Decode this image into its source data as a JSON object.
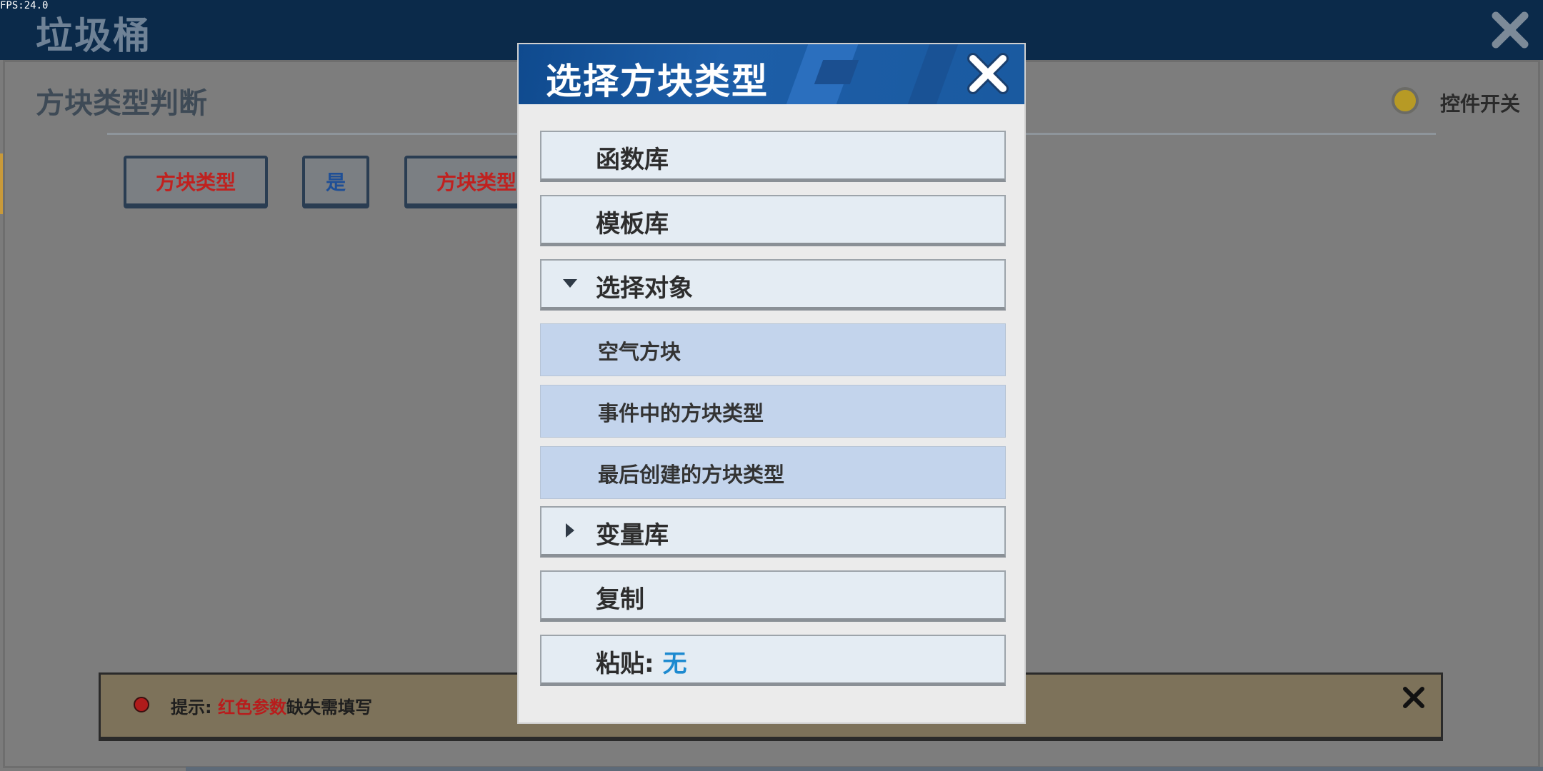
{
  "fps": "FPS:24.0",
  "app": {
    "title": "垃圾桶"
  },
  "section": {
    "title": "方块类型判断",
    "toggle_label": "控件开关"
  },
  "blocks": [
    {
      "label": "方块类型",
      "color": "#c0211f"
    },
    {
      "label": "是",
      "color": "#1f4f96"
    },
    {
      "label": "方块类型",
      "color": "#c0211f"
    }
  ],
  "hint": {
    "prefix": "提示: ",
    "highlight": "红色参数",
    "suffix": "缺失需填写"
  },
  "modal": {
    "title": "选择方块类型",
    "items": [
      {
        "label": "函数库",
        "arrow": ""
      },
      {
        "label": "模板库",
        "arrow": ""
      },
      {
        "label": "选择对象",
        "arrow": "down"
      },
      {
        "label": "变量库",
        "arrow": "right"
      },
      {
        "label": "复制",
        "arrow": ""
      }
    ],
    "subitems": [
      {
        "label": "空气方块"
      },
      {
        "label": "事件中的方块类型"
      },
      {
        "label": "最后创建的方块类型"
      }
    ],
    "paste_label": "粘贴: ",
    "paste_value": "无"
  },
  "icons": {
    "close": "close-icon",
    "expand": "triangle-down-icon",
    "collapse": "triangle-right-icon"
  }
}
